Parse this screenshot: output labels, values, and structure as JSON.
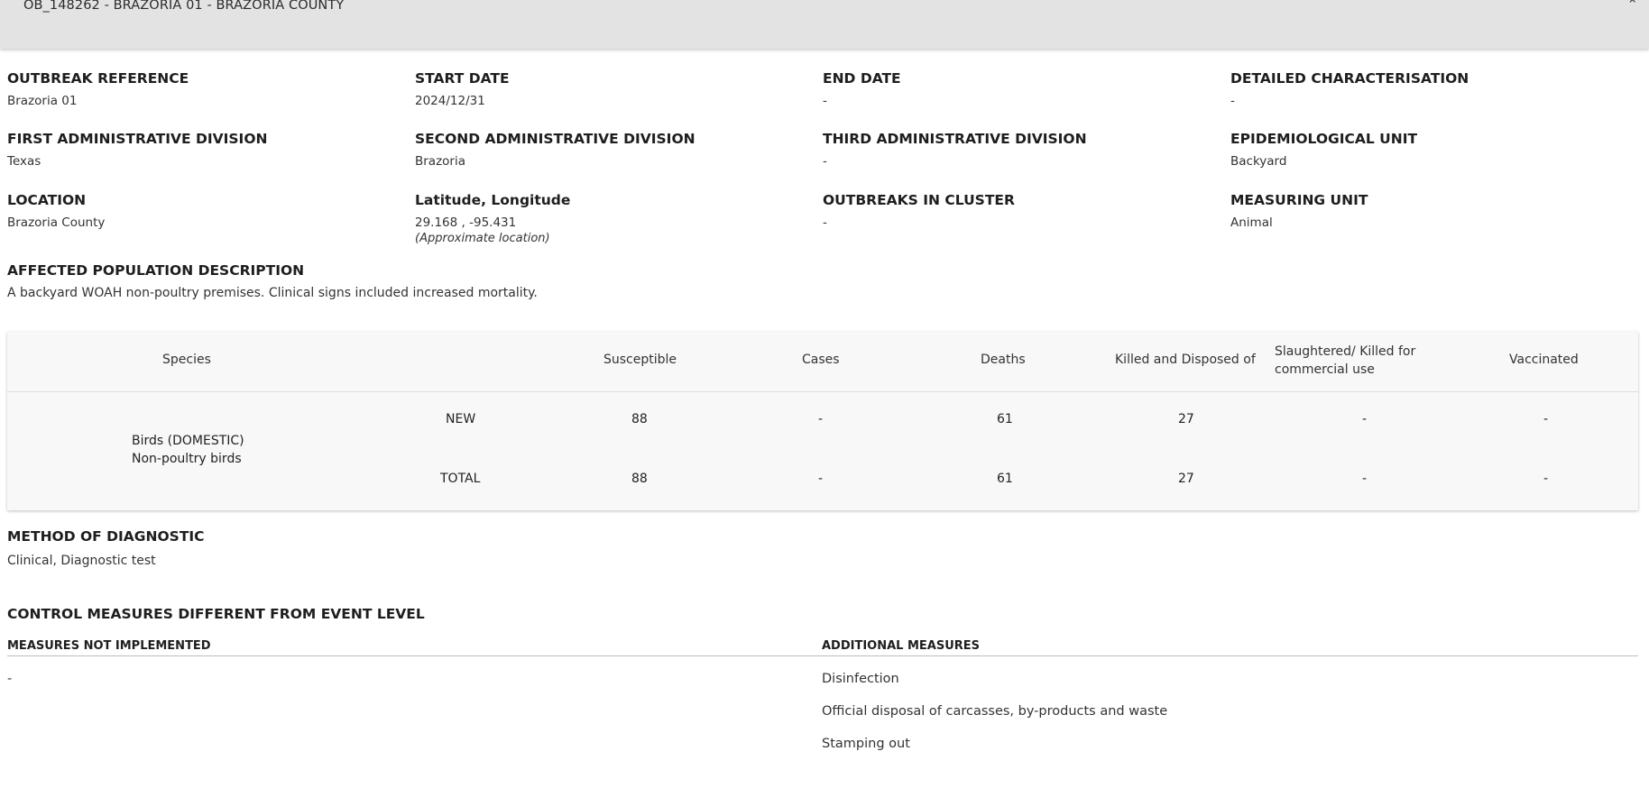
{
  "header": {
    "title": "OB_148262 - BRAZORIA 01 - BRAZORIA COUNTY"
  },
  "fields": {
    "outbreak_reference": {
      "label": "OUTBREAK REFERENCE",
      "value": "Brazoria 01"
    },
    "start_date": {
      "label": "START DATE",
      "value": "2024/12/31"
    },
    "end_date": {
      "label": "END DATE",
      "value": "-"
    },
    "detailed_characterisation": {
      "label": "DETAILED CHARACTERISATION",
      "value": "-"
    },
    "first_admin_division": {
      "label": "FIRST ADMINISTRATIVE DIVISION",
      "value": "Texas"
    },
    "second_admin_division": {
      "label": "SECOND ADMINISTRATIVE DIVISION",
      "value": "Brazoria"
    },
    "third_admin_division": {
      "label": "THIRD ADMINISTRATIVE DIVISION",
      "value": "-"
    },
    "epidemiological_unit": {
      "label": "EPIDEMIOLOGICAL UNIT",
      "value": "Backyard"
    },
    "location": {
      "label": "LOCATION",
      "value": "Brazoria County"
    },
    "lat_long": {
      "label": "Latitude, Longitude",
      "value": "29.168 , -95.431",
      "note": "(Approximate location)"
    },
    "outbreaks_in_cluster": {
      "label": "OUTBREAKS IN CLUSTER",
      "value": "-"
    },
    "measuring_unit": {
      "label": "MEASURING UNIT",
      "value": "Animal"
    },
    "affected_population": {
      "label": "AFFECTED POPULATION DESCRIPTION",
      "value": "A backyard WOAH non-poultry premises. Clinical signs included increased mortality."
    }
  },
  "table": {
    "headers": {
      "species": "Species",
      "susceptible": "Susceptible",
      "cases": "Cases",
      "deaths": "Deaths",
      "killed": "Killed and Disposed of",
      "slaughtered": "Slaughtered/ Killed for commercial use",
      "vaccinated": "Vaccinated"
    },
    "species_line1": "Birds (DOMESTIC)",
    "species_line2": "Non-poultry birds",
    "rows": [
      {
        "type": "NEW",
        "susceptible": "88",
        "cases": "-",
        "deaths": "61",
        "killed": "27",
        "slaughtered": "-",
        "vaccinated": "-"
      },
      {
        "type": "TOTAL",
        "susceptible": "88",
        "cases": "-",
        "deaths": "61",
        "killed": "27",
        "slaughtered": "-",
        "vaccinated": "-"
      }
    ]
  },
  "diagnostic": {
    "label": "METHOD OF DIAGNOSTIC",
    "value": "Clinical, Diagnostic test"
  },
  "control_measures": {
    "label": "CONTROL MEASURES DIFFERENT FROM EVENT LEVEL",
    "not_implemented_label": "MEASURES NOT IMPLEMENTED",
    "not_implemented_value": "-",
    "additional_label": "ADDITIONAL MEASURES",
    "additional_items": [
      "Disinfection",
      "Official disposal of carcasses, by-products and waste",
      "Stamping out"
    ]
  }
}
